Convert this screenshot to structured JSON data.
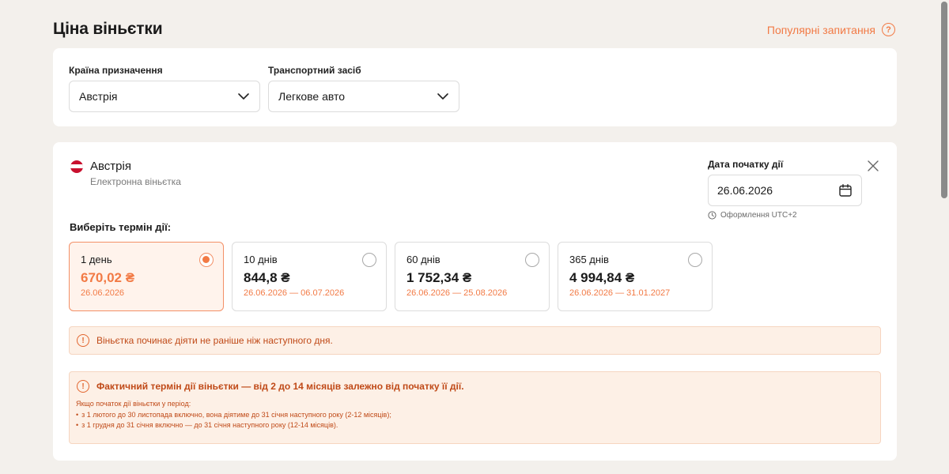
{
  "header": {
    "title": "Ціна віньєтки",
    "faq_link": "Популярні запитання",
    "faq_icon": "?"
  },
  "filters": {
    "country_label": "Країна призначення",
    "country_value": "Австрія",
    "vehicle_label": "Транспортний засіб",
    "vehicle_value": "Легкове авто"
  },
  "vignette": {
    "country": "Австрія",
    "subtitle": "Електронна віньєтка",
    "date_label": "Дата початку дії",
    "date_value": "26.06.2026",
    "date_note": "Оформлення UTC+2",
    "choose_label": "Виберіть термін дії:",
    "options": [
      {
        "duration": "1 день",
        "price": "670,02 ₴",
        "range": "26.06.2026",
        "selected": true
      },
      {
        "duration": "10 днів",
        "price": "844,8 ₴",
        "range": "26.06.2026 — 06.07.2026",
        "selected": false
      },
      {
        "duration": "60 днів",
        "price": "1 752,34 ₴",
        "range": "26.06.2026 — 25.08.2026",
        "selected": false
      },
      {
        "duration": "365 днів",
        "price": "4 994,84 ₴",
        "range": "26.06.2026 — 31.01.2027",
        "selected": false
      }
    ]
  },
  "notices": {
    "icon": "!",
    "start_notice": "Віньєтка починає діяти не раніше ніж наступного дня.",
    "term_title": "Фактичний термін дії віньєтки — від 2 до 14 місяців залежно від початку її дії.",
    "term_intro": "Якщо початок дії віньєтки у період:",
    "term_items": [
      "з 1 лютого до 30 листопада включно, вона діятиме до 31 січня наступного року (2-12 місяців);",
      "з 1 грудня до 31 січня включно — до 31 січня наступного року (12-14 місяців)."
    ]
  },
  "colors": {
    "accent": "#f27a45",
    "notice_bg": "#fdf0e6",
    "notice_text": "#c04a18",
    "page_bg": "#f3f0ec"
  }
}
